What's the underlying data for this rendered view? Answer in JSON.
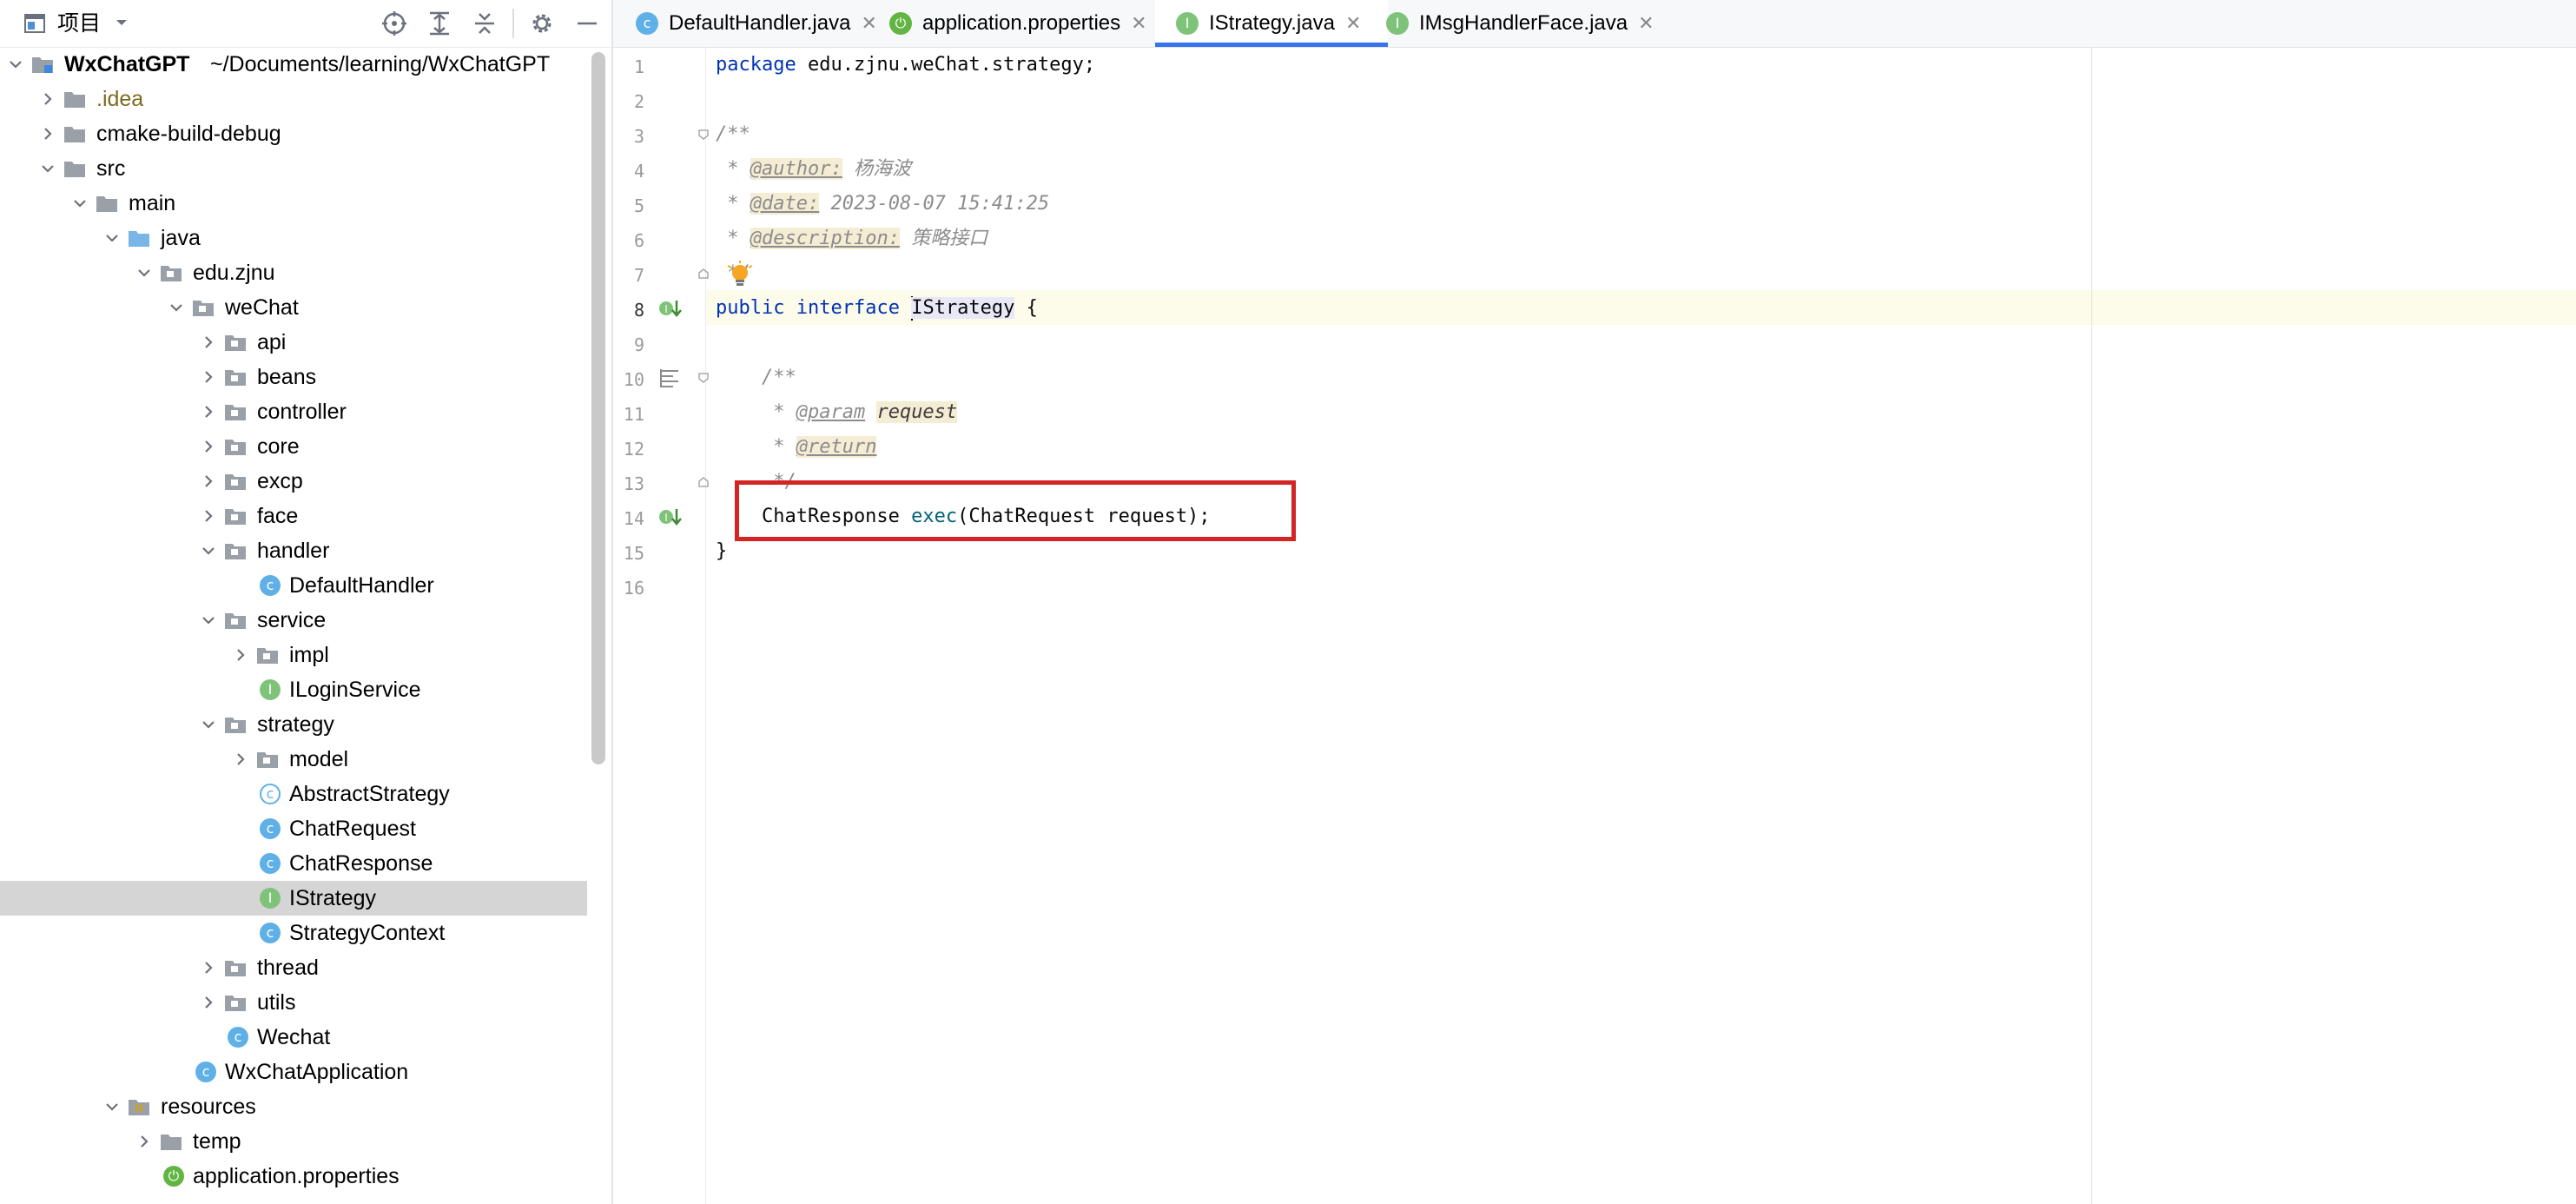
{
  "project_panel": {
    "title": "项目",
    "tree": [
      {
        "label": "WxChatGPT",
        "extra": "~/Documents/learning/WxChatGPT",
        "depth": 0,
        "expanded": true,
        "icon": "project-folder-icon",
        "root": true
      },
      {
        "label": ".idea",
        "depth": 1,
        "expanded": false,
        "icon": "folder-icon",
        "excluded": true
      },
      {
        "label": "cmake-build-debug",
        "depth": 1,
        "expanded": false,
        "icon": "folder-icon"
      },
      {
        "label": "src",
        "depth": 1,
        "expanded": true,
        "icon": "folder-icon"
      },
      {
        "label": "main",
        "depth": 2,
        "expanded": true,
        "icon": "folder-icon"
      },
      {
        "label": "java",
        "depth": 3,
        "expanded": true,
        "icon": "source-folder-icon"
      },
      {
        "label": "edu.zjnu",
        "depth": 4,
        "expanded": true,
        "icon": "package-icon"
      },
      {
        "label": "weChat",
        "depth": 5,
        "expanded": true,
        "icon": "package-icon"
      },
      {
        "label": "api",
        "depth": 6,
        "expanded": false,
        "icon": "package-icon"
      },
      {
        "label": "beans",
        "depth": 6,
        "expanded": false,
        "icon": "package-icon"
      },
      {
        "label": "controller",
        "depth": 6,
        "expanded": false,
        "icon": "package-icon"
      },
      {
        "label": "core",
        "depth": 6,
        "expanded": false,
        "icon": "package-icon"
      },
      {
        "label": "excp",
        "depth": 6,
        "expanded": false,
        "icon": "package-icon"
      },
      {
        "label": "face",
        "depth": 6,
        "expanded": false,
        "icon": "package-icon"
      },
      {
        "label": "handler",
        "depth": 6,
        "expanded": true,
        "icon": "package-icon"
      },
      {
        "label": "DefaultHandler",
        "depth": 7,
        "icon": "class-icon"
      },
      {
        "label": "service",
        "depth": 6,
        "expanded": true,
        "icon": "package-icon"
      },
      {
        "label": "impl",
        "depth": 7,
        "expanded": false,
        "icon": "package-icon"
      },
      {
        "label": "ILoginService",
        "depth": 7,
        "icon": "interface-icon"
      },
      {
        "label": "strategy",
        "depth": 6,
        "expanded": true,
        "icon": "package-icon"
      },
      {
        "label": "model",
        "depth": 7,
        "expanded": false,
        "icon": "package-icon"
      },
      {
        "label": "AbstractStrategy",
        "depth": 7,
        "icon": "abstract-class-icon"
      },
      {
        "label": "ChatRequest",
        "depth": 7,
        "icon": "class-icon"
      },
      {
        "label": "ChatResponse",
        "depth": 7,
        "icon": "class-icon"
      },
      {
        "label": "IStrategy",
        "depth": 7,
        "icon": "interface-icon",
        "selected": true
      },
      {
        "label": "StrategyContext",
        "depth": 7,
        "icon": "class-icon"
      },
      {
        "label": "thread",
        "depth": 6,
        "expanded": false,
        "icon": "package-icon"
      },
      {
        "label": "utils",
        "depth": 6,
        "expanded": false,
        "icon": "package-icon"
      },
      {
        "label": "Wechat",
        "depth": 6,
        "icon": "class-icon"
      },
      {
        "label": "WxChatApplication",
        "depth": 5,
        "icon": "spring-class-icon"
      },
      {
        "label": "resources",
        "depth": 3,
        "expanded": true,
        "icon": "resources-folder-icon"
      },
      {
        "label": "temp",
        "depth": 4,
        "expanded": false,
        "icon": "folder-icon"
      },
      {
        "label": "application.properties",
        "depth": 4,
        "icon": "spring-properties-icon"
      }
    ]
  },
  "tabs": [
    {
      "label": "DefaultHandler.java",
      "icon": "class-icon",
      "active": false
    },
    {
      "label": "application.properties",
      "icon": "spring-properties-icon",
      "active": false
    },
    {
      "label": "IStrategy.java",
      "icon": "interface-icon",
      "active": true
    },
    {
      "label": "IMsgHandlerFace.java",
      "icon": "interface-icon",
      "active": false
    }
  ],
  "editor": {
    "line_numbers": [
      "1",
      "2",
      "3",
      "4",
      "5",
      "6",
      "7",
      "8",
      "9",
      "10",
      "11",
      "12",
      "13",
      "14",
      "15",
      "16"
    ],
    "current_line": "8",
    "code": {
      "l1_kw": "package",
      "l1_rest": " edu.zjnu.weChat.strategy;",
      "l3": "/**",
      "l4_star": " * ",
      "l4_tag": "@author:",
      "l4_val": " 杨海波",
      "l5_star": " * ",
      "l5_tag": "@date:",
      "l5_val": " 2023-08-07 15:41:25",
      "l6_star": " * ",
      "l6_tag": "@description:",
      "l6_val": " 策略接口",
      "l7": " */",
      "l8_kw1": "public",
      "l8_kw2": "interface",
      "l8_name": "IStrategy",
      "l8_rest": " {",
      "l10": "    /**",
      "l11_star": "     * ",
      "l11_tag": "@param",
      "l11_param": "request",
      "l12_star": "     * ",
      "l12_tag": "@return",
      "l13": "     */",
      "l14_type": "    ChatResponse ",
      "l14_fn": "exec",
      "l14_rest": "(ChatRequest request);",
      "l15": "}"
    }
  },
  "colors": {
    "accent": "#3574f0",
    "highlight_box": "#d42424",
    "keyword": "#0033b3",
    "comment": "#8c8c8c",
    "method": "#00627a"
  }
}
